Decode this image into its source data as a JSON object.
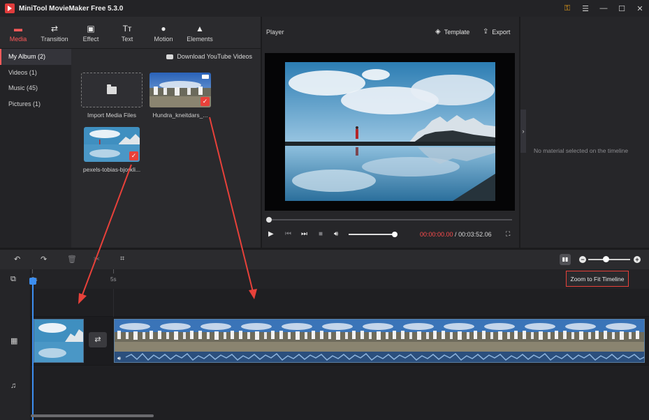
{
  "window": {
    "title": "MiniTool MovieMaker Free 5.3.0",
    "controls": [
      "⚿",
      "☰",
      "—",
      "☐",
      "✕"
    ]
  },
  "tabs": [
    {
      "label": "Media",
      "icon": "folder-icon",
      "glyph": "▬"
    },
    {
      "label": "Transition",
      "icon": "transition-icon",
      "glyph": "⇄"
    },
    {
      "label": "Effect",
      "icon": "effect-icon",
      "glyph": "▣"
    },
    {
      "label": "Text",
      "icon": "text-icon",
      "glyph": "Tт"
    },
    {
      "label": "Motion",
      "icon": "motion-icon",
      "glyph": "●"
    },
    {
      "label": "Elements",
      "icon": "elements-icon",
      "glyph": "▲"
    }
  ],
  "album": {
    "items": [
      "My Album (2)",
      "Videos (1)",
      "Music (45)",
      "Pictures (1)"
    ]
  },
  "media": {
    "download_label": "Download YouTube Videos",
    "import_label": "Import Media Files",
    "video_label": "Hundra_kneitdars_...",
    "photo_label": "pexels-tobias-bjorkli..."
  },
  "player": {
    "title": "Player",
    "template_label": "Template",
    "export_label": "Export",
    "current_time": "00:00:00.00",
    "separator": " / ",
    "total_time": "00:03:52.06",
    "seek_progress": 0.0,
    "volume_level": 0.95
  },
  "properties": {
    "empty_message": "No material selected on the timeline"
  },
  "timeline": {
    "ruler_ticks": [
      "0s",
      "5s"
    ],
    "zoom_fit_label": "Zoom to Fit Timeline",
    "zoom_level": 0.42
  },
  "colors": {
    "accent": "#ff5a5a",
    "playhead": "#3c8ef0",
    "annotation": "#e8413a"
  }
}
